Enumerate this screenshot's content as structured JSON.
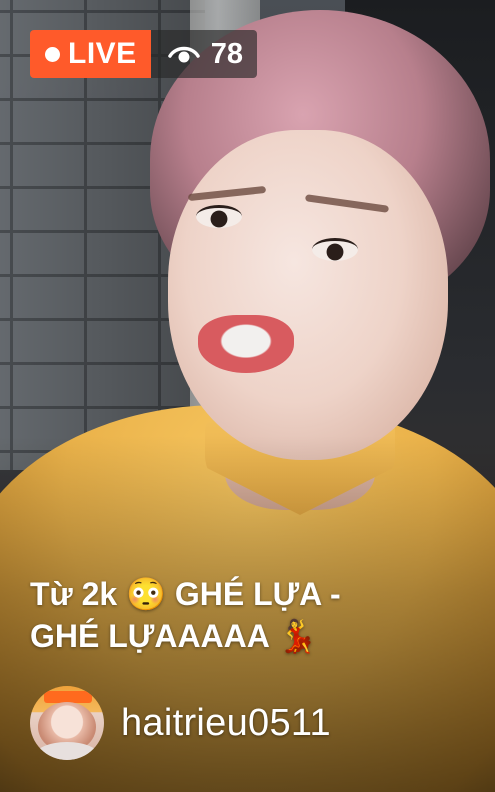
{
  "live_badge": {
    "label": "LIVE",
    "color": "#ff5a2a"
  },
  "viewers": {
    "icon": "eye-icon",
    "count": "78"
  },
  "stream": {
    "title_line1": "Từ 2k 😳 GHÉ LỰA -",
    "title_line2": "GHÉ LỰAAAAA 💃"
  },
  "streamer": {
    "avatar_icon": "avatar",
    "username": "haitrieu0511"
  }
}
